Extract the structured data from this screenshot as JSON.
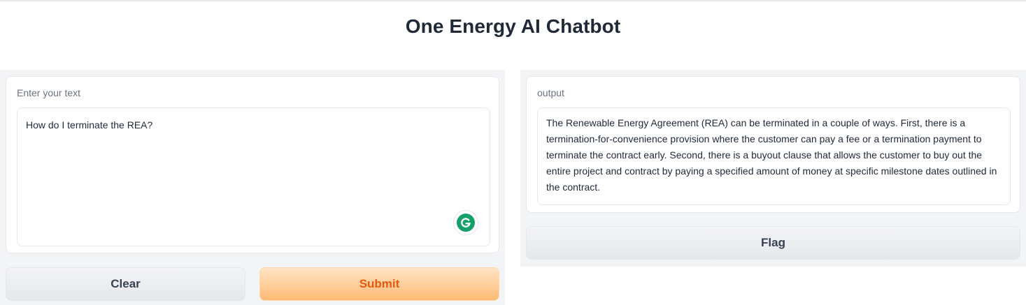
{
  "app": {
    "title": "One Energy AI Chatbot"
  },
  "input": {
    "label": "Enter your text",
    "value": "How do I terminate the REA?"
  },
  "output": {
    "label": "output",
    "text": "The Renewable Energy Agreement (REA) can be terminated in a couple of ways. First, there is a termination-for-convenience provision where the customer can pay a fee or a termination payment to terminate the contract early. Second, there is a buyout clause that allows the customer to buy out the entire project and contract by paying a specified amount of money at specific milestone dates outlined in the contract."
  },
  "buttons": {
    "clear": "Clear",
    "submit": "Submit",
    "flag": "Flag"
  },
  "icons": {
    "grammarly": "grammarly-icon"
  },
  "colors": {
    "accent_text": "#ea580c",
    "accent_bg": "#fdba74",
    "grammarly": "#15a06b"
  }
}
